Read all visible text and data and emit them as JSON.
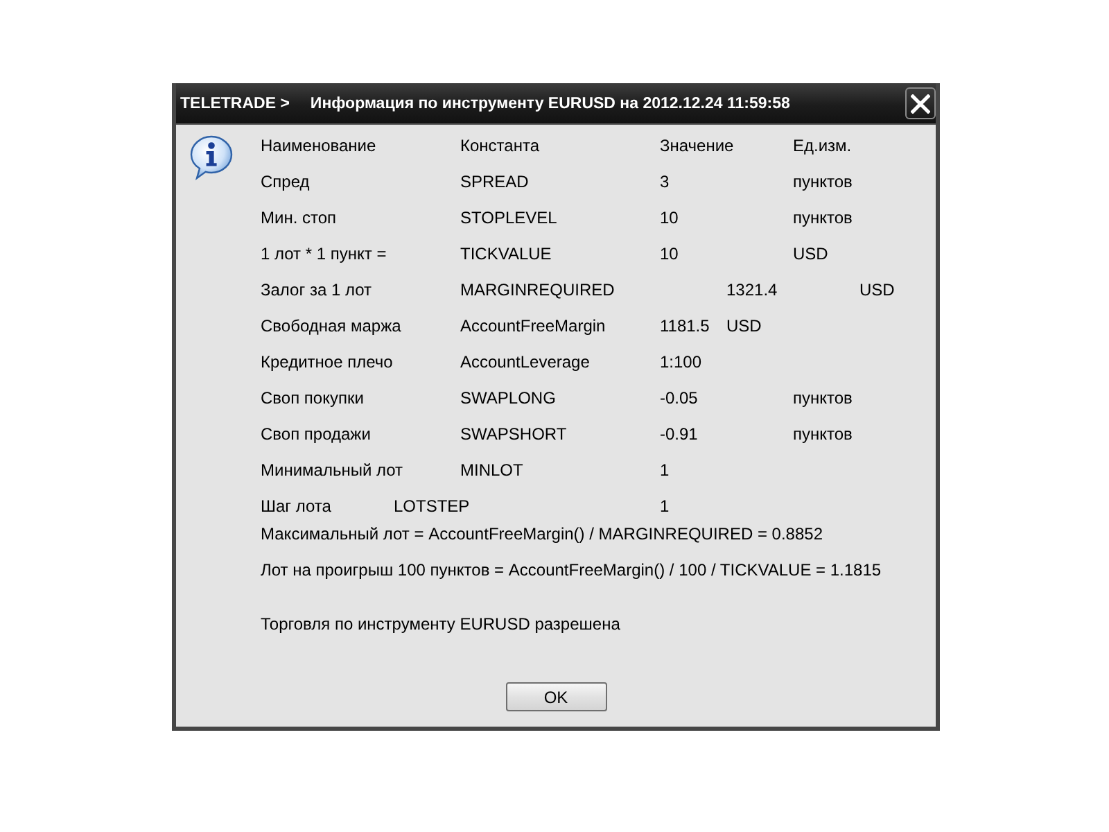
{
  "window": {
    "app_name": "TELETRADE >",
    "title": "Информация по инструменту EURUSD на 2012.12.24 11:59:58"
  },
  "table": {
    "columns": [
      "Наименование",
      "Константа",
      "Значение",
      "Ед.изм."
    ],
    "rows": [
      {
        "name": "Спред",
        "constant": "SPREAD",
        "value": "3",
        "unit": "пунктов"
      },
      {
        "name": "Мин. стоп",
        "constant": "STOPLEVEL",
        "value": "10",
        "unit": "пунктов"
      },
      {
        "name": "1 лот * 1 пункт =",
        "constant": "TICKVALUE",
        "value": "10",
        "unit": "USD"
      },
      {
        "name": "Залог за 1 лот",
        "constant": "MARGINREQUIRED",
        "value": "1321.4",
        "unit": "USD"
      },
      {
        "name": "Свободная маржа",
        "constant": "AccountFreeMargin",
        "value": "1181.5",
        "unit": "USD"
      },
      {
        "name": "Кредитное плечо",
        "constant": "AccountLeverage",
        "value": "1:100"
      },
      {
        "name": "Своп покупки",
        "constant": "SWAPLONG",
        "value": "-0.05",
        "unit": "пунктов"
      },
      {
        "name": "Своп продажи",
        "constant": "SWAPSHORT",
        "value": "-0.91",
        "unit": "пунктов"
      },
      {
        "name": "Минимальный лот",
        "constant": "MINLOT",
        "value": "1"
      },
      {
        "name": "Шаг лота",
        "constant": "LOTSTEP",
        "value": "1"
      }
    ]
  },
  "formulas": [
    "Максимальный лот = AccountFreeMargin() / MARGINREQUIRED = 0.8852",
    "Лот на проигрыш 100 пунктов = AccountFreeMargin() / 100 / TICKVALUE = 1.1815"
  ],
  "status_message": "Торговля по инструменту EURUSD разрешена",
  "buttons": [
    "OK"
  ]
}
